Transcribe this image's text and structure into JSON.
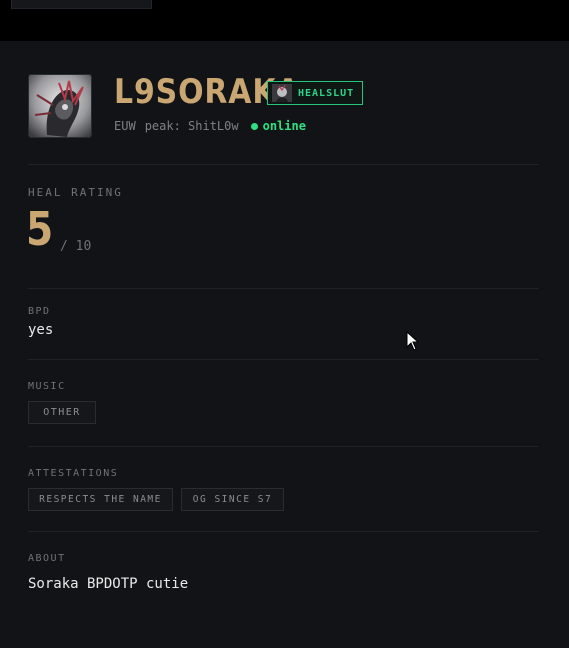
{
  "profile": {
    "name": "L9SORAKA",
    "badge": "HEALSLUT",
    "region": "EUW",
    "peak": "peak: ShitL0w",
    "status": "online"
  },
  "heal_rating": {
    "label": "HEAL RATING",
    "value": "5",
    "max": "/ 10"
  },
  "bpd": {
    "label": "BPD",
    "value": "yes"
  },
  "music": {
    "label": "MUSIC",
    "tags": [
      "OTHER"
    ]
  },
  "attestations": {
    "label": "ATTESTATIONS",
    "items": [
      "RESPECTS THE NAME",
      "OG SINCE S7"
    ]
  },
  "about": {
    "label": "ABOUT",
    "text": "Soraka BPDOTP cutie"
  },
  "colors": {
    "accent_gold": "#c9a672",
    "online_green": "#2fe083",
    "background": "#121316",
    "top_bar": "#000000"
  },
  "icons": {
    "avatar": "avatar-image",
    "badge": "badge-avatar-icon",
    "status": "online-dot-icon",
    "cursor": "mouse-cursor-icon"
  }
}
